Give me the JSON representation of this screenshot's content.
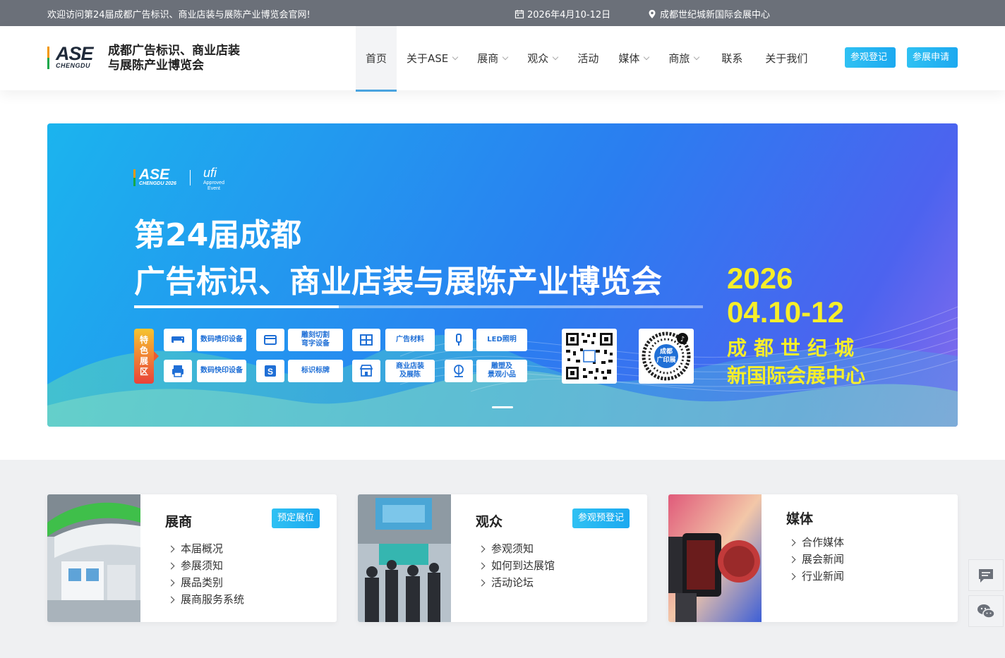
{
  "topbar": {
    "welcome": "欢迎访问第24届成都广告标识、商业店装与展陈产业博览会官网!",
    "date": "2026年4月10-12日",
    "venue": "成都世纪城新国际会展中心"
  },
  "header": {
    "logo": {
      "main": "ASE",
      "sub": "CHENGDU"
    },
    "site_name": "成都广告标识、商业店装与展陈产业博览会",
    "nav": [
      {
        "label": "首页",
        "active": true,
        "dropdown": false
      },
      {
        "label": "关于ASE",
        "dropdown": true
      },
      {
        "label": "展商",
        "dropdown": true
      },
      {
        "label": "观众",
        "dropdown": true
      },
      {
        "label": "活动",
        "dropdown": false
      },
      {
        "label": "媒体",
        "dropdown": true
      },
      {
        "label": "商旅",
        "dropdown": true
      },
      {
        "label": "联系",
        "dropdown": false
      },
      {
        "label": "关于我们",
        "dropdown": false
      }
    ],
    "buttons": {
      "register": "参观登记",
      "apply": "参展申请"
    }
  },
  "banner": {
    "logo_main": "ASE",
    "logo_sub": "CHENGDU 2026",
    "ufi": "ufi",
    "ufi_sub1": "Approved",
    "ufi_sub2": "Event",
    "title_line1": "第24届成都",
    "title_line2": "广告标识、商业店装与展陈产业博览会",
    "year": "2026",
    "dates": "04.10-12",
    "city": "成都世纪城",
    "venue": "新国际会展中心",
    "zone_tag": "特色展区",
    "zones": [
      "数码喷印设备",
      "雕刻切割\n弯字设备",
      "广告材料",
      "LED照明",
      "数码快印设备",
      "标识标牌",
      "商业店装\n及展陈",
      "雕塑及\n景观小品"
    ],
    "qr2_label": "成都\n广印展",
    "colors": {
      "accent_yellow": "#f6ee2a",
      "banner_start": "#1bb4ee",
      "banner_end": "#8a6cec"
    }
  },
  "cards": [
    {
      "title": "展商",
      "button": "预定展位",
      "links": [
        "本届概况",
        "参展须知",
        "展品类别",
        "展商服务系统"
      ]
    },
    {
      "title": "观众",
      "button": "参观预登记",
      "links": [
        "参观须知",
        "如何到达展馆",
        "活动论坛"
      ]
    },
    {
      "title": "媒体",
      "button": "",
      "links": [
        "合作媒体",
        "展会新闻",
        "行业新闻"
      ]
    }
  ],
  "side_tools": [
    "message-icon",
    "wechat-icon"
  ],
  "colors": {
    "topbar": "#6b7079",
    "button_blue": "#1ca9f0",
    "nav_active_underline": "#4aa3df"
  }
}
